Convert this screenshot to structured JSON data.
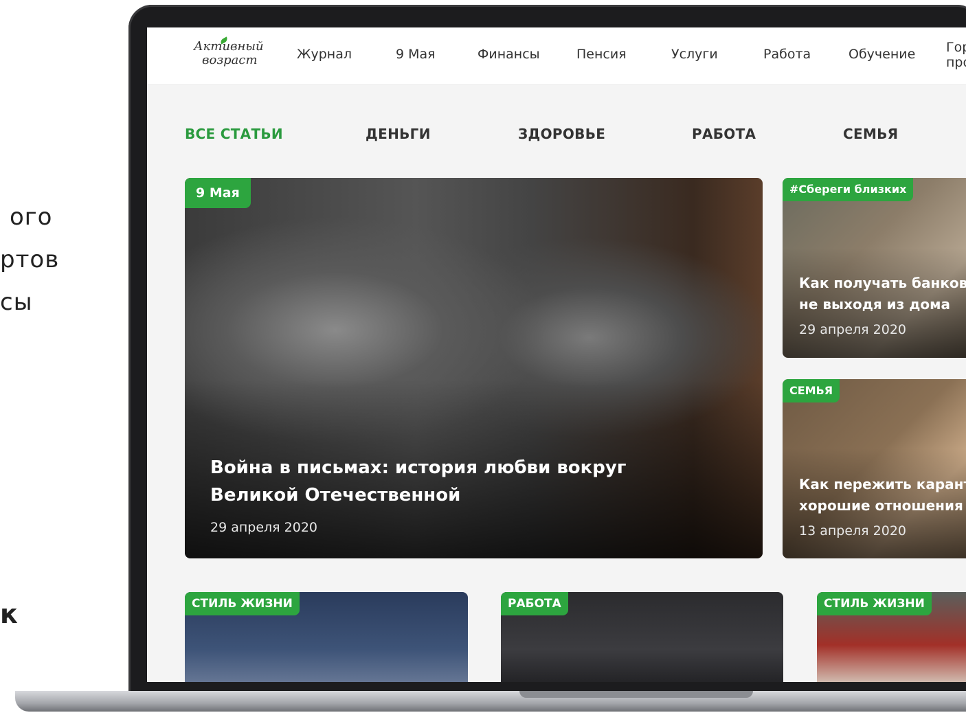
{
  "slide_text": {
    "line1": "ого",
    "line2": "ртов",
    "line3": "сы",
    "line4": "к"
  },
  "site": {
    "logo": {
      "line1": "Активный",
      "line2": "возраст"
    },
    "nav": [
      "Журнал",
      "9 Мая",
      "Финансы",
      "Пенсия",
      "Услуги",
      "Работа",
      "Обучение",
      "Гор",
      "про"
    ]
  },
  "tabs": [
    "ВСЕ СТАТЬИ",
    "ДЕНЬГИ",
    "ЗДОРОВЬЕ",
    "РАБОТА",
    "СЕМЬЯ"
  ],
  "hero": {
    "badge": "9 Мая",
    "title_line1": "Война в письмах: история любви вокруг",
    "title_line2": "Великой Отечественной",
    "date": "29 апреля 2020"
  },
  "side_cards": [
    {
      "badge": "#Сбереги близких",
      "title_line1": "Как получать банковск",
      "title_line2": "не выходя из дома",
      "date": "29 апреля 2020"
    },
    {
      "badge": "СЕМЬЯ",
      "title_line1": "Как пережить каранти",
      "title_line2": "хорошие отношения в",
      "date": "13 апреля 2020"
    }
  ],
  "bottom_cards": [
    {
      "badge": "СТИЛЬ ЖИЗНИ"
    },
    {
      "badge": "РАБОТА"
    },
    {
      "badge": "СТИЛЬ ЖИЗНИ"
    }
  ],
  "colors": {
    "accent": "#2da53f",
    "tab_active": "#2a9a3e"
  }
}
